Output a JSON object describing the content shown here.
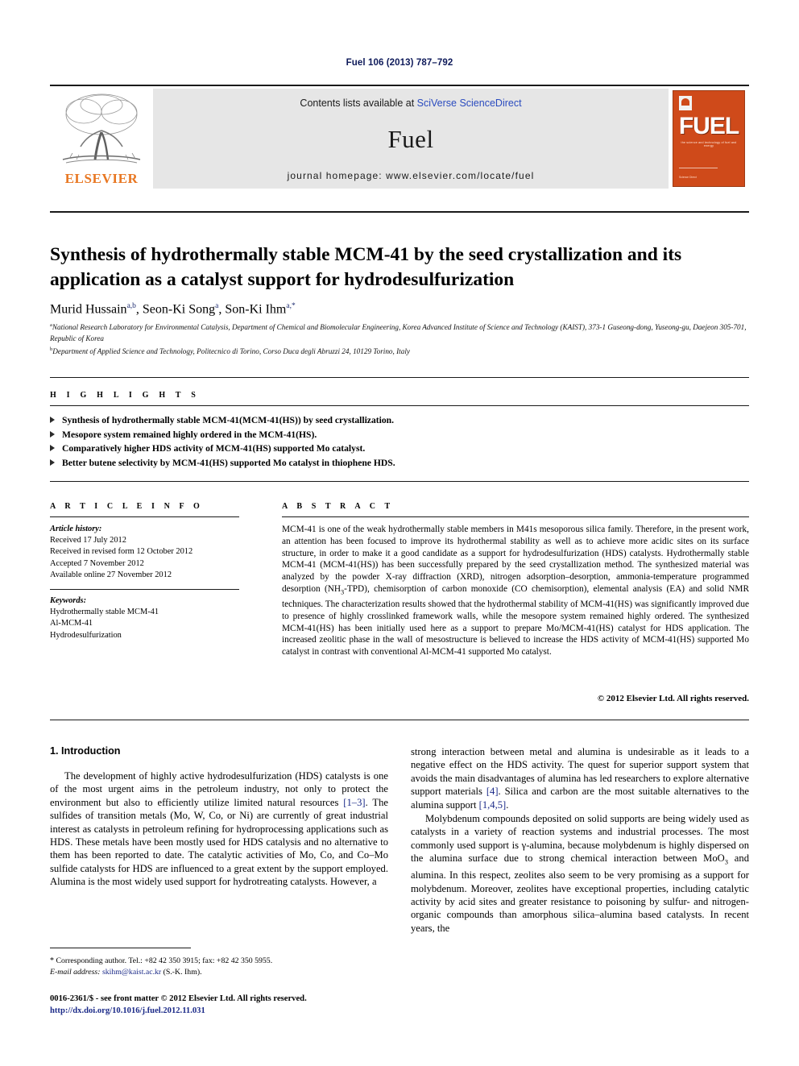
{
  "running_head": "Fuel 106 (2013) 787–792",
  "masthead": {
    "publisher_name": "ELSEVIER",
    "contents_prefix": "Contents lists available at ",
    "contents_link": "SciVerse ScienceDirect",
    "journal_name": "Fuel",
    "homepage": "journal homepage: www.elsevier.com/locate/fuel",
    "cover": {
      "title": "FUEL",
      "tagline": "the science and technology of fuel and energy",
      "footer": "Science Direct"
    },
    "accent_color": "#e87722",
    "link_color": "#2a4bbf",
    "cover_color": "#cf4a1a"
  },
  "article": {
    "title": "Synthesis of hydrothermally stable MCM-41 by the seed crystallization and its application as a catalyst support for hydrodesulfurization",
    "authors": [
      {
        "name": "Murid Hussain",
        "sup": "a,b"
      },
      {
        "name": "Seon-Ki Song",
        "sup": "a"
      },
      {
        "name": "Son-Ki Ihm",
        "sup": "a,*"
      }
    ],
    "affiliations": [
      {
        "marker": "a",
        "text": "National Research Laboratory for Environmental Catalysis, Department of Chemical and Biomolecular Engineering, Korea Advanced Institute of Science and Technology (KAIST), 373-1 Guseong-dong, Yuseong-gu, Daejeon 305-701, Republic of Korea"
      },
      {
        "marker": "b",
        "text": "Department of Applied Science and Technology, Politecnico di Torino, Corso Duca degli Abruzzi 24, 10129 Torino, Italy"
      }
    ]
  },
  "highlights": {
    "heading": "H I G H L I G H T S",
    "items": [
      "Synthesis of hydrothermally stable MCM-41(MCM-41(HS)) by seed crystallization.",
      "Mesopore system remained highly ordered in the MCM-41(HS).",
      "Comparatively higher HDS activity of MCM-41(HS) supported Mo catalyst.",
      "Better butene selectivity by MCM-41(HS) supported Mo catalyst in thiophene HDS."
    ]
  },
  "article_info": {
    "heading": "A R T I C L E    I N F O",
    "history_label": "Article history:",
    "history": [
      "Received 17 July 2012",
      "Received in revised form 12 October 2012",
      "Accepted 7 November 2012",
      "Available online 27 November 2012"
    ],
    "keywords_label": "Keywords:",
    "keywords": [
      "Hydrothermally stable MCM-41",
      "Al-MCM-41",
      "Hydrodesulfurization"
    ]
  },
  "abstract": {
    "heading": "A B S T R A C T",
    "text_part1": "MCM-41 is one of the weak hydrothermally stable members in M41s mesoporous silica family. Therefore, in the present work, an attention has been focused to improve its hydrothermal stability as well as to achieve more acidic sites on its surface structure, in order to make it a good candidate as a support for hydrodesulfurization (HDS) catalysts. Hydrothermally stable MCM-41 (MCM-41(HS)) has been successfully prepared by the seed crystallization method. The synthesized material was analyzed by the powder X-ray diffraction (XRD), nitrogen adsorption–desorption, ammonia-temperature programmed desorption (NH",
    "sub1": "3",
    "text_part2": "-TPD), chemisorption of carbon monoxide (CO chemisorption), elemental analysis (EA) and solid NMR techniques. The characterization results showed that the hydrothermal stability of MCM-41(HS) was significantly improved due to presence of highly crosslinked framework walls, while the mesopore system remained highly ordered. The synthesized MCM-41(HS) has been initially used here as a support to prepare Mo/MCM-41(HS) catalyst for HDS application. The increased zeolitic phase in the wall of mesostructure is believed to increase the HDS activity of MCM-41(HS) supported Mo catalyst in contrast with conventional Al-MCM-41 supported Mo catalyst.",
    "copyright": "© 2012 Elsevier Ltd. All rights reserved."
  },
  "body": {
    "section_heading": "1. Introduction",
    "left_para1_a": "The development of highly active hydrodesulfurization (HDS) catalysts is one of the most urgent aims in the petroleum industry, not only to protect the environment but also to efficiently utilize limited natural resources ",
    "left_para1_ref1": "[1–3]",
    "left_para1_b": ". The sulfides of transition metals (Mo, W, Co, or Ni) are currently of great industrial interest as catalysts in petroleum refining for hydroprocessing applications such as HDS. These metals have been mostly used for HDS catalysis and no alternative to them has been reported to date. The catalytic activities of Mo, Co, and Co–Mo sulfide catalysts for HDS are influenced to a great extent by the support employed. Alumina is the most widely used support for hydrotreating catalysts. However, a",
    "right_para1_a": "strong interaction between metal and alumina is undesirable as it leads to a negative effect on the HDS activity. The quest for superior support system that avoids the main disadvantages of alumina has led researchers to explore alternative support materials ",
    "right_para1_ref1": "[4]",
    "right_para1_b": ". Silica and carbon are the most suitable alternatives to the alumina support ",
    "right_para1_ref2": "[1,4,5]",
    "right_para1_c": ".",
    "right_para2_a": "Molybdenum compounds deposited on solid supports are being widely used as catalysts in a variety of reaction systems and industrial processes. The most commonly used support is γ-alumina, because molybdenum is highly dispersed on the alumina surface due to strong chemical interaction between MoO",
    "right_para2_sub": "3",
    "right_para2_b": " and alumina. In this respect, zeolites also seem to be very promising as a support for molybdenum. Moreover, zeolites have exceptional properties, including catalytic activity by acid sites and greater resistance to poisoning by sulfur- and nitrogen-organic compounds than amorphous silica–alumina based catalysts. In recent years, the"
  },
  "footnote": {
    "star": "*",
    "corresponding": " Corresponding author. Tel.: +82 42 350 3915; fax: +82 42 350 5955.",
    "email_label": "E-mail address:",
    "email": "skihm@kaist.ac.kr",
    "email_owner": " (S.-K. Ihm)."
  },
  "imprint": {
    "line1": "0016-2361/$ - see front matter © 2012 Elsevier Ltd. All rights reserved.",
    "doi": "http://dx.doi.org/10.1016/j.fuel.2012.11.031"
  }
}
